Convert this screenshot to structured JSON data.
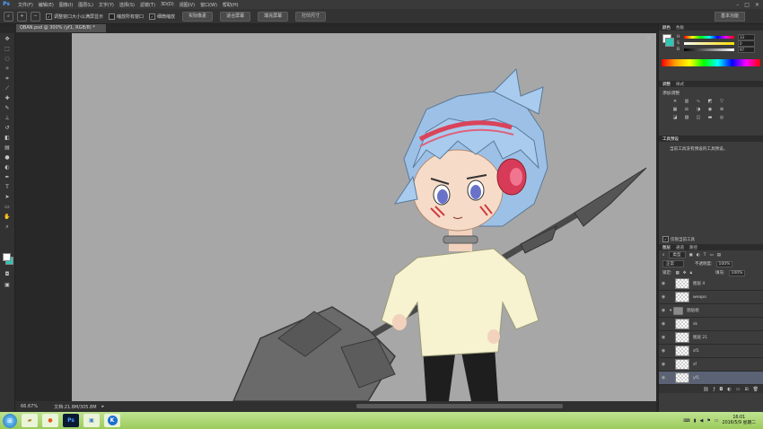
{
  "app": {
    "logo": "Ps"
  },
  "menu": [
    "文件(F)",
    "编辑(E)",
    "图像(I)",
    "图层(L)",
    "文字(Y)",
    "选择(S)",
    "滤镜(T)",
    "3D(D)",
    "视图(V)",
    "窗口(W)",
    "帮助(H)"
  ],
  "options_bar": {
    "checks": [
      {
        "label": "调整窗口大小以满屏显示",
        "checked": true
      },
      {
        "label": "缩放所有窗口",
        "checked": false
      },
      {
        "label": "细微缩放",
        "checked": true
      }
    ],
    "buttons": [
      "实际像素",
      "适合屏幕",
      "填充屏幕",
      "打印尺寸"
    ],
    "workspace": "基本功能"
  },
  "document": {
    "tab_title": "QBAN.psd @ 300% (yf1, RGB/8) *",
    "zoom": "66.67%",
    "doc_size": "文档:21.8M/305.8M"
  },
  "color_panel": {
    "tabs": [
      "颜色",
      "色板"
    ],
    "sliders": [
      {
        "label": "H",
        "value": "33"
      },
      {
        "label": "S",
        "value": "0"
      },
      {
        "label": "B",
        "value": "97"
      }
    ],
    "unit": "%",
    "fg": "#ffffff",
    "bg": "#2fc7b4"
  },
  "adjust_panel": {
    "tabs": [
      "调整",
      "样式"
    ],
    "title": "添加调整"
  },
  "tool_presets": {
    "title": "工具预设",
    "message": "当前工具没有预设的工具预设。",
    "footer": "仅限当前工具"
  },
  "layers_panel": {
    "tabs": [
      "图层",
      "通道",
      "路径"
    ],
    "filter": "类型",
    "blend_mode": "正常",
    "opacity_label": "不透明度:",
    "opacity": "100%",
    "lock_label": "锁定:",
    "fill_label": "填充:",
    "fill": "100%",
    "layers": [
      {
        "name": "图层 4",
        "type": "layer",
        "selected": false
      },
      {
        "name": "weapo",
        "type": "layer",
        "selected": false
      },
      {
        "name": "图层组",
        "type": "group",
        "selected": false
      },
      {
        "name": "sk",
        "type": "layer",
        "selected": false
      },
      {
        "name": "图层 21",
        "type": "layer",
        "selected": false
      },
      {
        "name": "sf1",
        "type": "layer",
        "selected": false
      },
      {
        "name": "sf",
        "type": "layer",
        "selected": false
      },
      {
        "name": "yf1",
        "type": "layer",
        "selected": true
      }
    ]
  },
  "taskbar": {
    "apps": [
      "文件管理器",
      "浏览器",
      "Ps",
      "图片",
      "K"
    ],
    "time": "16:01",
    "date": "2016/5/9 星期二"
  }
}
